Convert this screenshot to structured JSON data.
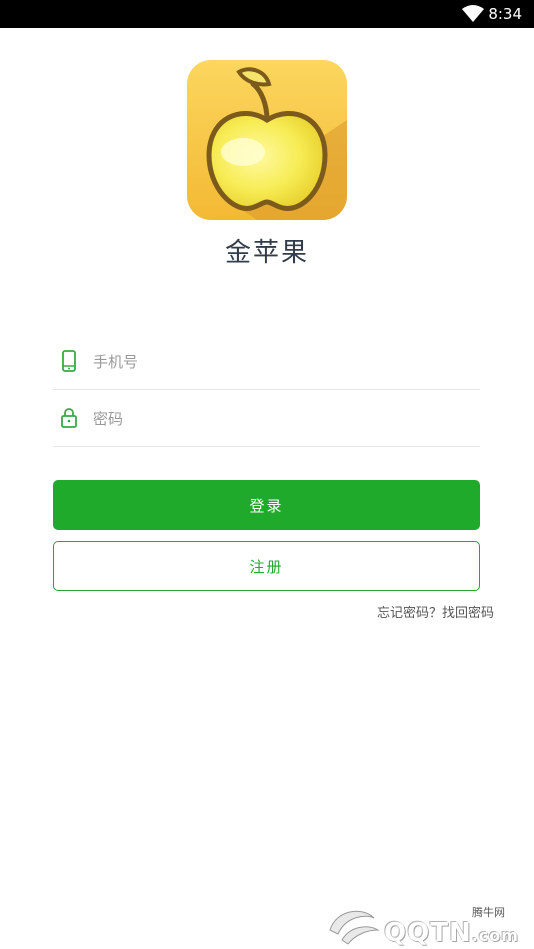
{
  "status_bar": {
    "time": "8:34",
    "icons": [
      "wifi-icon"
    ]
  },
  "app": {
    "name": "金苹果",
    "logo": "golden-apple-logo"
  },
  "form": {
    "phone": {
      "placeholder": "手机号",
      "value": "",
      "icon": "phone-icon"
    },
    "password": {
      "placeholder": "密码",
      "value": "",
      "icon": "lock-icon"
    }
  },
  "actions": {
    "login_label": "登录",
    "register_label": "注册",
    "forgot_label": "忘记密码？找回密码"
  },
  "watermark": {
    "chinese": "腾牛网",
    "latin": "QQTN",
    "suffix": ".com"
  },
  "colors": {
    "accent": "#1faa2b",
    "status_bar": "#000000",
    "title": "#333d4a"
  }
}
